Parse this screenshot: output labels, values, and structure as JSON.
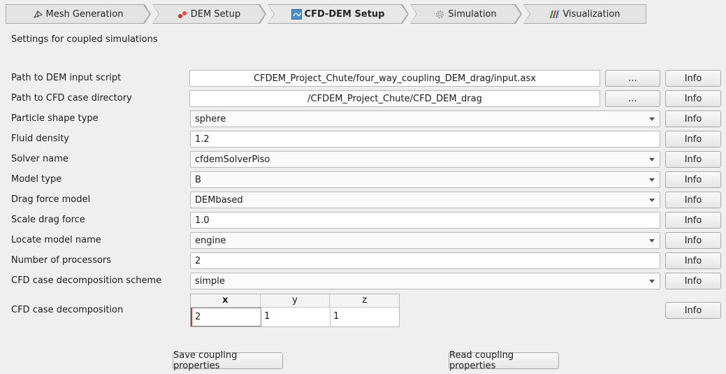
{
  "tabs": [
    {
      "label": "Mesh Generation",
      "icon": "mesh-icon"
    },
    {
      "label": "DEM Setup",
      "icon": "dem-icon"
    },
    {
      "label": "CFD-DEM Setup",
      "icon": "cfd-dem-icon",
      "active": true
    },
    {
      "label": "Simulation",
      "icon": "gear-icon"
    },
    {
      "label": "Visualization",
      "icon": "paraview-icon"
    }
  ],
  "section_title": "Settings for coupled simulations",
  "browse_label": "...",
  "info_label": "Info",
  "rows": {
    "dem_script": {
      "label": "Path to DEM input script",
      "value": "CFDEM_Project_Chute/four_way_coupling_DEM_drag/input.asx"
    },
    "cfd_dir": {
      "label": "Path to CFD case directory",
      "value": "/CFDEM_Project_Chute/CFD_DEM_drag"
    },
    "particle_shape": {
      "label": "Particle shape type",
      "value": "sphere"
    },
    "fluid_density": {
      "label": "Fluid density",
      "value": "1.2"
    },
    "solver_name": {
      "label": "Solver name",
      "value": "cfdemSolverPiso"
    },
    "model_type": {
      "label": "Model type",
      "value": "B"
    },
    "drag_model": {
      "label": "Drag force model",
      "value": "DEMbased"
    },
    "scale_drag": {
      "label": "Scale drag force",
      "value": "1.0"
    },
    "locate_model": {
      "label": "Locate model name",
      "value": "engine"
    },
    "num_procs": {
      "label": "Number of processors",
      "value": "2"
    },
    "decomp_scheme": {
      "label": "CFD case decomposition scheme",
      "value": "simple"
    },
    "decomposition": {
      "label": "CFD case decomposition",
      "headers": [
        "x",
        "y",
        "z"
      ],
      "values": [
        "2",
        "1",
        "1"
      ]
    }
  },
  "actions": {
    "save_label": "Save coupling properties",
    "read_label": "Read coupling properties"
  }
}
